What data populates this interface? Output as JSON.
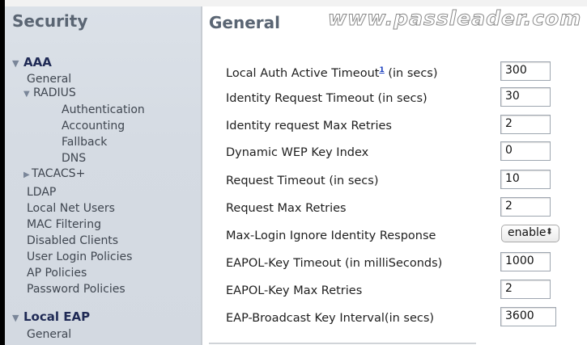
{
  "sidebar": {
    "title": "Security",
    "aaa": {
      "label": "AAA",
      "general": "General",
      "radius": {
        "label": "RADIUS",
        "items": [
          "Authentication",
          "Accounting",
          "Fallback",
          "DNS"
        ]
      },
      "tacacs": "TACACS+",
      "items": [
        "LDAP",
        "Local Net Users",
        "MAC Filtering",
        "Disabled Clients",
        "User Login Policies",
        "AP Policies",
        "Password Policies"
      ]
    },
    "local_eap": {
      "label": "Local EAP",
      "general": "General"
    }
  },
  "main": {
    "title": "General",
    "watermark": "www.passleader.com",
    "fields": [
      {
        "label": "Local Auth Active Timeout",
        "footnote": "1",
        "suffix": " (in secs)",
        "value": "300"
      },
      {
        "label": "Identity Request Timeout (in secs)",
        "value": "30"
      },
      {
        "label": "Identity request Max Retries",
        "value": "2"
      },
      {
        "label": "Dynamic WEP Key Index",
        "value": "0"
      },
      {
        "label": "Request Timeout (in secs)",
        "value": "10"
      },
      {
        "label": "Request Max Retries",
        "value": "2"
      },
      {
        "label": "Max-Login Ignore Identity Response",
        "value": "enable"
      },
      {
        "label": "EAPOL-Key Timeout (in milliSeconds)",
        "value": "1000"
      },
      {
        "label": "EAPOL-Key Max Retries",
        "value": "2"
      },
      {
        "label": "EAP-Broadcast Key Interval(in secs)",
        "value": "3600"
      }
    ]
  },
  "icons": {
    "expanded": "triangle-down-icon",
    "collapsed": "triangle-right-icon",
    "select_arrow": "up-down-arrows-icon"
  }
}
